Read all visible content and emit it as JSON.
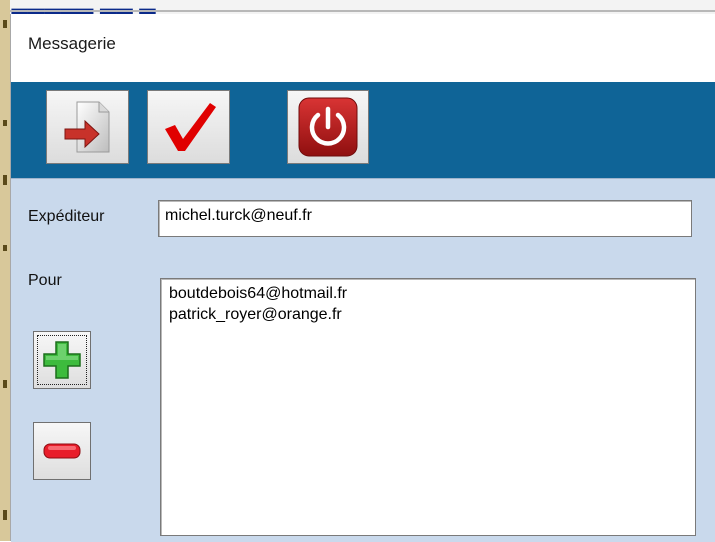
{
  "window": {
    "title": "Messagerie"
  },
  "toolbar": {
    "buttons": [
      {
        "icon": "document-arrow-icon"
      },
      {
        "icon": "checkmark-icon"
      },
      {
        "icon": "power-icon"
      }
    ]
  },
  "form": {
    "sender_label": "Expéditeur",
    "sender_value": "michel.turck@neuf.fr",
    "recipients_label": "Pour",
    "recipients": [
      "boutdebois64@hotmail.fr",
      "patrick_royer@orange.fr"
    ],
    "add_icon": "plus-icon",
    "remove_icon": "minus-icon"
  },
  "colors": {
    "toolbar": "#0f6497",
    "client_background": "#c9d9ec",
    "check_red": "#e00000",
    "power_red": "#b01818",
    "plus_green": "#3dbb3d",
    "minus_red": "#e81d2a"
  }
}
